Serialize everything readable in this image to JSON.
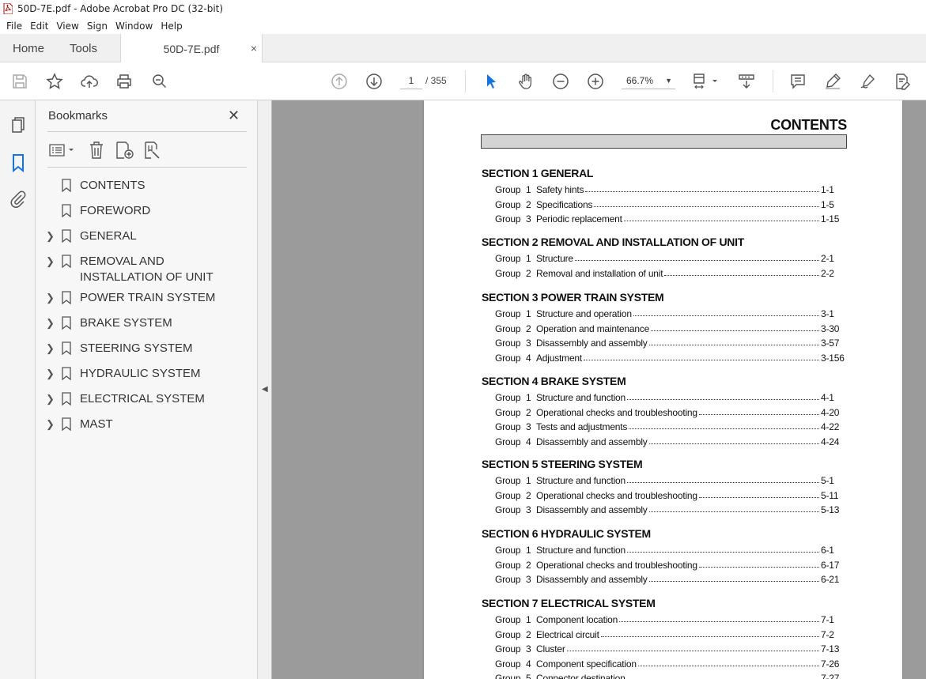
{
  "window": {
    "title": "50D-7E.pdf - Adobe Acrobat Pro DC (32-bit)"
  },
  "menu": [
    "File",
    "Edit",
    "View",
    "Sign",
    "Window",
    "Help"
  ],
  "tabs": {
    "home": "Home",
    "tools": "Tools",
    "doc": "50D-7E.pdf",
    "close": "×"
  },
  "toolbar": {
    "page_current": "1",
    "page_total": "/ 355",
    "zoom": "66.7%",
    "zoom_caret": "▼"
  },
  "bookmarks": {
    "title": "Bookmarks",
    "close": "✕",
    "items": [
      {
        "label": "CONTENTS",
        "expandable": false
      },
      {
        "label": "FOREWORD",
        "expandable": false
      },
      {
        "label": "GENERAL",
        "expandable": true
      },
      {
        "label": "REMOVAL AND INSTALLATION OF UNIT",
        "expandable": true
      },
      {
        "label": "POWER TRAIN SYSTEM",
        "expandable": true
      },
      {
        "label": "BRAKE SYSTEM",
        "expandable": true
      },
      {
        "label": "STEERING SYSTEM",
        "expandable": true
      },
      {
        "label": "HYDRAULIC SYSTEM",
        "expandable": true
      },
      {
        "label": "ELECTRICAL SYSTEM",
        "expandable": true
      },
      {
        "label": "MAST",
        "expandable": true
      }
    ]
  },
  "document": {
    "title": "CONTENTS",
    "sections": [
      {
        "heading": "SECTION 1  GENERAL",
        "groups": [
          {
            "group": "Group",
            "num": "1",
            "title": "Safety hints",
            "page": "1-1"
          },
          {
            "group": "Group",
            "num": "2",
            "title": "Specifications",
            "page": "1-5"
          },
          {
            "group": "Group",
            "num": "3",
            "title": "Periodic replacement",
            "page": "1-15"
          }
        ]
      },
      {
        "heading": "SECTION 2  REMOVAL AND INSTALLATION OF UNIT",
        "groups": [
          {
            "group": "Group",
            "num": "1",
            "title": "Structure",
            "page": "2-1"
          },
          {
            "group": "Group",
            "num": "2",
            "title": "Removal and installation of unit",
            "page": "2-2"
          }
        ]
      },
      {
        "heading": "SECTION 3  POWER TRAIN SYSTEM",
        "groups": [
          {
            "group": "Group",
            "num": "1",
            "title": "Structure and operation",
            "page": "3-1"
          },
          {
            "group": "Group",
            "num": "2",
            "title": "Operation and maintenance",
            "page": "3-30"
          },
          {
            "group": "Group",
            "num": "3",
            "title": "Disassembly and assembly",
            "page": "3-57"
          },
          {
            "group": "Group",
            "num": "4",
            "title": "Adjustment",
            "page": "3-156"
          }
        ]
      },
      {
        "heading": "SECTION 4  BRAKE SYSTEM",
        "groups": [
          {
            "group": "Group",
            "num": "1",
            "title": "Structure and function",
            "page": "4-1"
          },
          {
            "group": "Group",
            "num": "2",
            "title": "Operational checks and troubleshooting",
            "page": "4-20"
          },
          {
            "group": "Group",
            "num": "3",
            "title": "Tests and adjustments",
            "page": "4-22"
          },
          {
            "group": "Group",
            "num": "4",
            "title": "Disassembly and assembly",
            "page": "4-24"
          }
        ]
      },
      {
        "heading": "SECTION 5  STEERING SYSTEM",
        "groups": [
          {
            "group": "Group",
            "num": "1",
            "title": "Structure and function",
            "page": "5-1"
          },
          {
            "group": "Group",
            "num": "2",
            "title": "Operational checks and troubleshooting",
            "page": "5-11"
          },
          {
            "group": "Group",
            "num": "3",
            "title": "Disassembly and assembly",
            "page": "5-13"
          }
        ]
      },
      {
        "heading": "SECTION 6  HYDRAULIC SYSTEM",
        "groups": [
          {
            "group": "Group",
            "num": "1",
            "title": "Structure and function",
            "page": "6-1"
          },
          {
            "group": "Group",
            "num": "2",
            "title": "Operational checks and troubleshooting",
            "page": "6-17"
          },
          {
            "group": "Group",
            "num": "3",
            "title": "Disassembly and assembly",
            "page": "6-21"
          }
        ]
      },
      {
        "heading": "SECTION 7  ELECTRICAL SYSTEM",
        "groups": [
          {
            "group": "Group",
            "num": "1",
            "title": "Component location",
            "page": "7-1"
          },
          {
            "group": "Group",
            "num": "2",
            "title": "Electrical circuit",
            "page": "7-2"
          },
          {
            "group": "Group",
            "num": "3",
            "title": "Cluster",
            "page": "7-13"
          },
          {
            "group": "Group",
            "num": "4",
            "title": "Component specification",
            "page": "7-26"
          },
          {
            "group": "Group",
            "num": "5",
            "title": "Connector destination",
            "page": "7-27"
          }
        ]
      }
    ]
  }
}
